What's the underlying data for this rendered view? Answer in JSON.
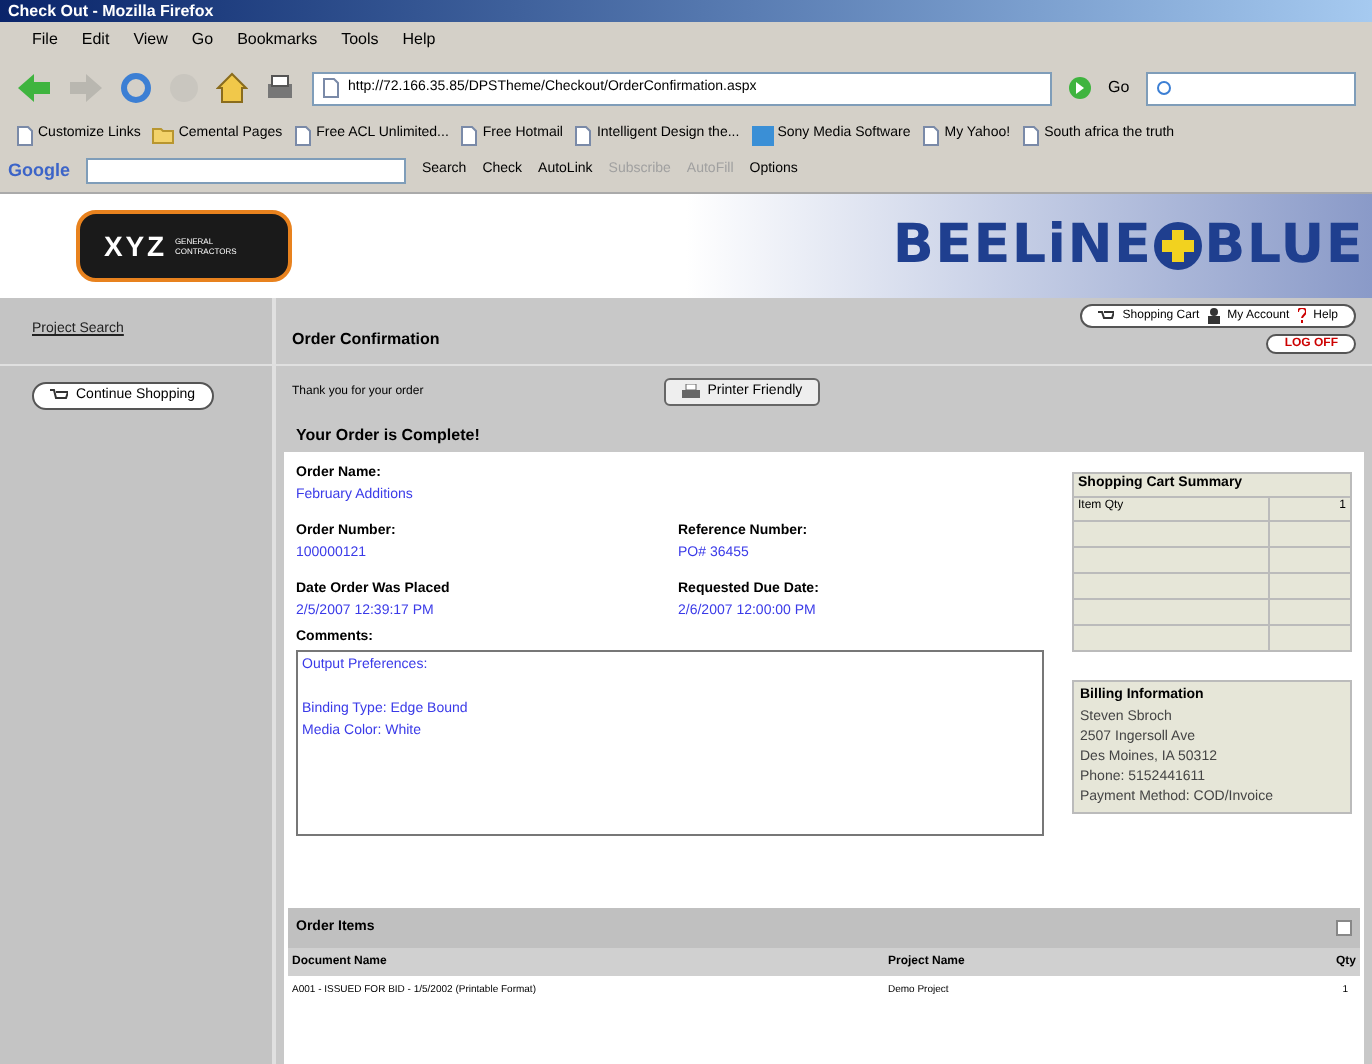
{
  "window": {
    "title": "Check Out - Mozilla Firefox"
  },
  "menu": [
    "File",
    "Edit",
    "View",
    "Go",
    "Bookmarks",
    "Tools",
    "Help"
  ],
  "address": {
    "url": "http://72.166.35.85/DPSTheme/Checkout/OrderConfirmation.aspx",
    "go": "Go"
  },
  "bookmarks": [
    {
      "label": "Customize Links",
      "kind": "page"
    },
    {
      "label": "Cemental Pages",
      "kind": "folder"
    },
    {
      "label": "Free ACL Unlimited...",
      "kind": "page"
    },
    {
      "label": "Free Hotmail",
      "kind": "page"
    },
    {
      "label": "Intelligent Design the...",
      "kind": "page"
    },
    {
      "label": "Sony Media Software",
      "kind": "app"
    },
    {
      "label": "My Yahoo!",
      "kind": "page"
    },
    {
      "label": "South africa the truth",
      "kind": "page"
    }
  ],
  "google_toolbar": {
    "logo": "Google",
    "items": [
      {
        "label": "Search",
        "disabled": false
      },
      {
        "label": "Check",
        "disabled": false
      },
      {
        "label": "AutoLink",
        "disabled": false
      },
      {
        "label": "Subscribe",
        "disabled": true
      },
      {
        "label": "AutoFill",
        "disabled": true
      },
      {
        "label": "Options",
        "disabled": false
      }
    ]
  },
  "header": {
    "logo_main": "XYZ",
    "logo_sub": "GENERAL CONTRACTORS",
    "brand_left": "BEELiNE",
    "brand_right": "BLUE"
  },
  "sidebar": {
    "link": "Project Search",
    "button": "Continue Shopping"
  },
  "page": {
    "title": "Order Confirmation",
    "top_links": [
      "Shopping Cart",
      "My Account",
      "Help"
    ],
    "logoff": "LOG OFF",
    "thanks": "Thank you for your order",
    "printer": "Printer Friendly",
    "complete": "Your Order is Complete!"
  },
  "fields": [
    {
      "label": "Order Name:",
      "value": "February Additions"
    },
    {
      "label": "Order Number:",
      "value": "100000121"
    },
    {
      "label": "Reference Number:",
      "value": "PO# 36455"
    },
    {
      "label": "Date Order Was Placed",
      "value": "2/5/2007 12:39:17 PM"
    },
    {
      "label": "Requested Due Date:",
      "value": "2/6/2007 12:00:00 PM"
    }
  ],
  "comments": {
    "label": "Comments:",
    "paragraphs": [
      [
        "Output Preferences:"
      ],
      [
        "Binding Type: Edge Bound",
        "Media Color: White"
      ]
    ]
  },
  "cart_summary": {
    "title": "Shopping Cart Summary",
    "rows": [
      [
        "Item Qty",
        "1"
      ]
    ]
  },
  "billing": {
    "title": "Billing Information",
    "lines": [
      "Steven Sbroch",
      "2507 Ingersoll Ave",
      "Des Moines, IA 50312",
      "Phone: 5152441611",
      "Payment Method: COD/Invoice"
    ]
  },
  "order_items": {
    "title": "Order Items",
    "columns": [
      "Document Name",
      "Project Name",
      "Qty"
    ],
    "rows": [
      [
        "A001 - ISSUED FOR BID - 1/5/2002 (Printable Format)",
        "Demo Project",
        "1"
      ]
    ]
  }
}
